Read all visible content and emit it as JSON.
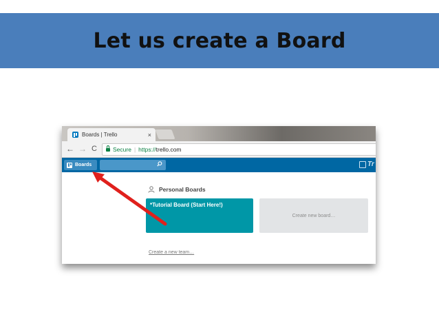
{
  "slide": {
    "title": "Let us create a Board"
  },
  "browser": {
    "tab_title": "Boards | Trello",
    "tab_close": "×",
    "back": "←",
    "forward": "→",
    "reload": "C",
    "secure_label": "Secure",
    "url_scheme": "https://",
    "url_host": "trello.com"
  },
  "trello": {
    "boards_button": "Boards",
    "logo_text": "Tr",
    "section_title": "Personal Boards",
    "board_tile": "*Tutorial Board (Start Here!)",
    "create_tile": "Create new board…",
    "create_team": "Create a new team…"
  },
  "colors": {
    "banner": "#4a7ebb",
    "trello_header": "#0067a3",
    "board_tile": "#0097a7",
    "arrow": "#e0201c"
  }
}
